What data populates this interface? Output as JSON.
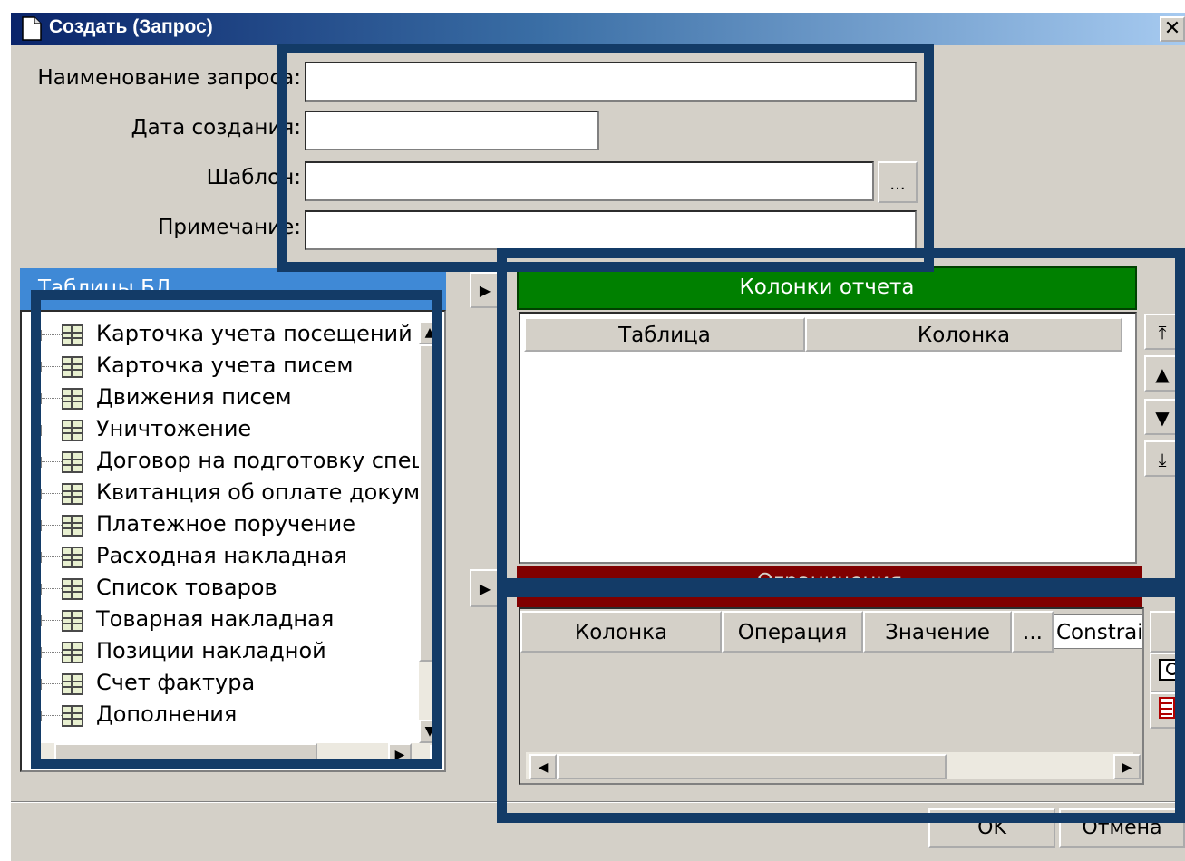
{
  "window": {
    "title": "Создать (Запрос)",
    "close_glyph": "✕"
  },
  "form": {
    "name_label": "Наименование запроса:",
    "name_value": "",
    "date_label": "Дата создания:",
    "date_value": "",
    "template_label": "Шаблон:",
    "template_value": "",
    "template_browse_label": "...",
    "note_label": "Примечание:",
    "note_value": ""
  },
  "tables_panel": {
    "header": "Таблицы БД",
    "items": [
      "Карточка учета посещений",
      "Карточка учета писем",
      "Движения писем",
      "Уничтожение",
      "Договор на подготовку спец",
      "Квитанция об оплате докум",
      "Платежное поручение",
      "Расходная накладная",
      "Список товаров",
      "Товарная накладная",
      "Позиции накладной",
      "Счет фактура",
      "Дополнения"
    ]
  },
  "report_columns": {
    "header": "Колонки отчета",
    "add_glyph": "▶",
    "headers": [
      "Таблица",
      "Колонка"
    ],
    "move_buttons": [
      "⤒",
      "▲",
      "▼",
      "⤓"
    ]
  },
  "constraints": {
    "header": "Ограничения",
    "add_glyph": "▶",
    "headers": [
      "Колонка",
      "Операция",
      "Значение",
      "...",
      "Constrai"
    ]
  },
  "footer": {
    "ok_label": "OK",
    "cancel_label": "Отмена"
  },
  "colors": {
    "title_start": "#0a246a",
    "title_end": "#a6caf0",
    "dialog_bg": "#d4d0c8",
    "report_header_bg": "#008000",
    "constraints_header_bg": "#800000",
    "tables_header_bg": "#3f89d6",
    "highlight_frame": "#133b67"
  },
  "icons": {
    "window": "document-icon",
    "table_item": "table-grid-icon",
    "add": "triangle-right-icon",
    "move_top": "arrow-top-icon",
    "move_up": "arrow-up-icon",
    "move_down": "arrow-down-icon",
    "move_bottom": "arrow-bottom-icon"
  }
}
